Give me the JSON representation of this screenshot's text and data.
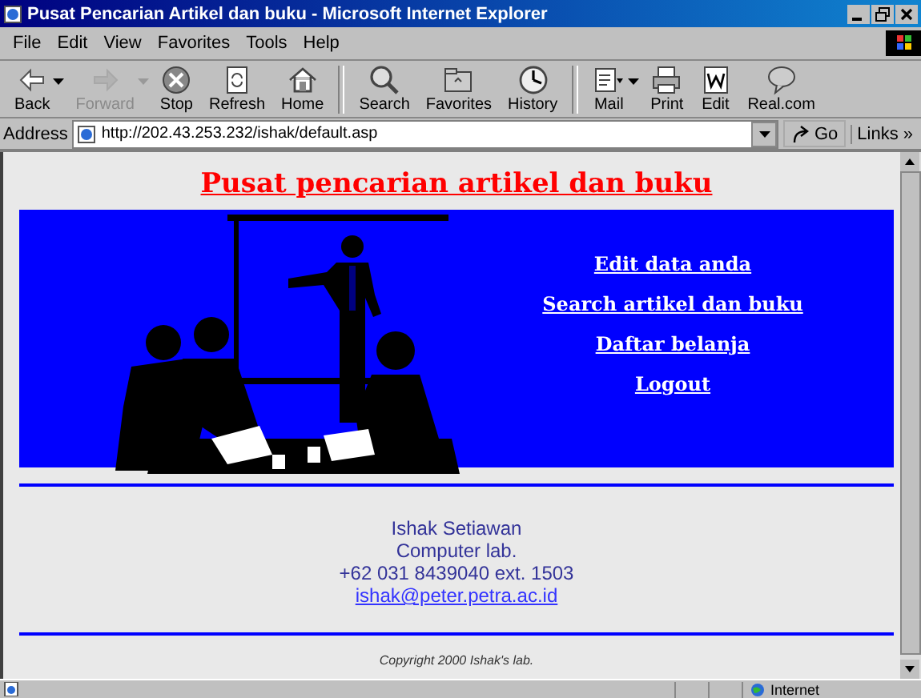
{
  "window": {
    "title": "Pusat Pencarian Artikel dan buku - Microsoft Internet Explorer"
  },
  "menu": [
    "File",
    "Edit",
    "View",
    "Favorites",
    "Tools",
    "Help"
  ],
  "toolbar": [
    {
      "buttons": [
        {
          "label": "Back",
          "disabled": false,
          "dropdown": true
        },
        {
          "label": "Forward",
          "disabled": true,
          "dropdown": true
        },
        {
          "label": "Stop",
          "disabled": false,
          "dropdown": false
        },
        {
          "label": "Refresh",
          "disabled": false,
          "dropdown": false
        },
        {
          "label": "Home",
          "disabled": false,
          "dropdown": false
        }
      ]
    },
    {
      "buttons": [
        {
          "label": "Search",
          "disabled": false,
          "dropdown": false
        },
        {
          "label": "Favorites",
          "disabled": false,
          "dropdown": false
        },
        {
          "label": "History",
          "disabled": false,
          "dropdown": false
        }
      ]
    },
    {
      "buttons": [
        {
          "label": "Mail",
          "disabled": false,
          "dropdown": true
        },
        {
          "label": "Print",
          "disabled": false,
          "dropdown": false
        },
        {
          "label": "Edit",
          "disabled": false,
          "dropdown": false
        },
        {
          "label": "Real.com",
          "disabled": false,
          "dropdown": false
        }
      ]
    }
  ],
  "address_bar": {
    "label": "Address",
    "value": "http://202.43.253.232/ishak/default.asp",
    "go": "Go",
    "links": "Links",
    "links_more": "»"
  },
  "page": {
    "heading": "Pusat pencarian artikel dan buku",
    "nav_links": [
      "Edit data anda",
      "Search artikel dan buku",
      "Daftar belanja",
      "Logout"
    ],
    "contact_lines": [
      "Ishak Setiawan",
      "Computer lab.",
      "+62 031 8439040 ext. 1503"
    ],
    "email": "ishak@peter.petra.ac.id",
    "copyright": "Copyright 2000 Ishak's lab."
  },
  "status_bar": {
    "zone": "Internet"
  }
}
